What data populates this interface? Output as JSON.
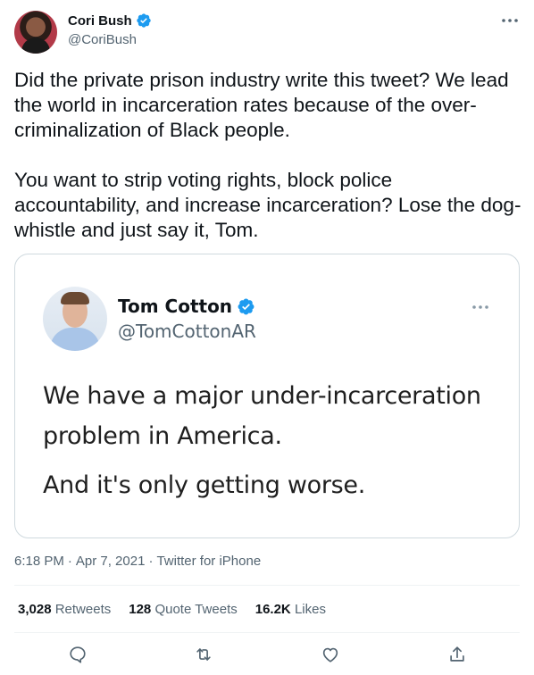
{
  "author": {
    "name": "Cori Bush",
    "handle": "@CoriBush",
    "avatar_icon": "profile-photo",
    "verified_icon": "verified-badge-icon",
    "verified_color": "#1d9bf0"
  },
  "tweet": {
    "text": "Did the private prison industry write this tweet? We lead the world in incarceration rates because of the over-criminalization of Black people.\n\nYou want to strip voting rights, block police accountability, and increase incarceration? Lose the dog-whistle and just say it, Tom."
  },
  "embedded": {
    "name": "Tom Cotton",
    "handle": "@TomCottonAR",
    "lines": [
      "We have a major under-incarceration",
      "problem in America.",
      "And it's only getting worse."
    ]
  },
  "meta": {
    "time": "6:18 PM",
    "date": "Apr 7, 2021",
    "separator": "·",
    "source": "Twitter for iPhone"
  },
  "stats": [
    {
      "count": "3,028",
      "label": "Retweets"
    },
    {
      "count": "128",
      "label": "Quote Tweets"
    },
    {
      "count": "16.2K",
      "label": "Likes"
    }
  ],
  "actions": [
    "reply-icon",
    "retweet-icon",
    "like-icon",
    "share-icon"
  ],
  "colors": {
    "text": "#0f1419",
    "secondary": "#536471",
    "border": "#cfd9de",
    "accent": "#1d9bf0"
  }
}
